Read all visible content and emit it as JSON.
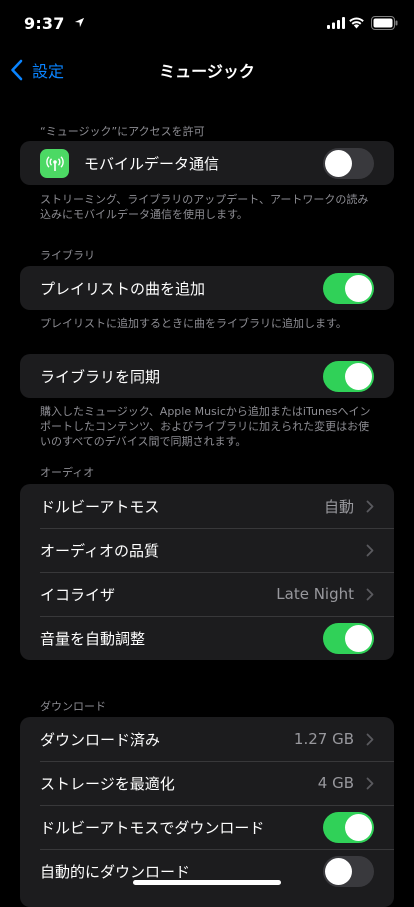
{
  "status_bar": {
    "time": "9:37"
  },
  "nav": {
    "back_label": "設定",
    "title": "ミュージック"
  },
  "sections": {
    "access": {
      "header": "“ミュージック”にアクセスを許可",
      "mobile_data": {
        "label": "モバイルデータ通信",
        "toggle": "off",
        "icon": "antenna-icon"
      },
      "footer": "ストリーミング、ライブラリのアップデート、アートワークの読み込みにモバイルデータ通信を使用します。"
    },
    "library": {
      "header": "ライブラリ",
      "add_playlist_songs": {
        "label": "プレイリストの曲を追加",
        "toggle": "on"
      },
      "add_playlist_footer": "プレイリストに追加するときに曲をライブラリに追加します。",
      "sync_library": {
        "label": "ライブラリを同期",
        "toggle": "on"
      },
      "sync_footer": "購入したミュージック、Apple Musicから追加またはiTunesへインポートしたコンテンツ、およびライブラリに加えられた変更はお使いのすべてのデバイス間で同期されます。"
    },
    "audio": {
      "header": "オーディオ",
      "dolby_atmos": {
        "label": "ドルビーアトモス",
        "value": "自動"
      },
      "audio_quality": {
        "label": "オーディオの品質"
      },
      "eq": {
        "label": "イコライザ",
        "value": "Late Night"
      },
      "sound_check": {
        "label": "音量を自動調整",
        "toggle": "on"
      }
    },
    "downloads": {
      "header": "ダウンロード",
      "downloaded": {
        "label": "ダウンロード済み",
        "value": "1.27 GB"
      },
      "optimize_storage": {
        "label": "ストレージを最適化",
        "value": "4 GB"
      },
      "download_dolby": {
        "label": "ドルビーアトモスでダウンロード",
        "toggle": "on"
      },
      "auto_download": {
        "label": "自動的にダウンロード",
        "toggle": "off"
      }
    }
  },
  "colors": {
    "accent": "#0a84ff",
    "toggle_on": "#30d158",
    "card_bg": "#1c1c1e",
    "icon_green": "#4cd964"
  }
}
